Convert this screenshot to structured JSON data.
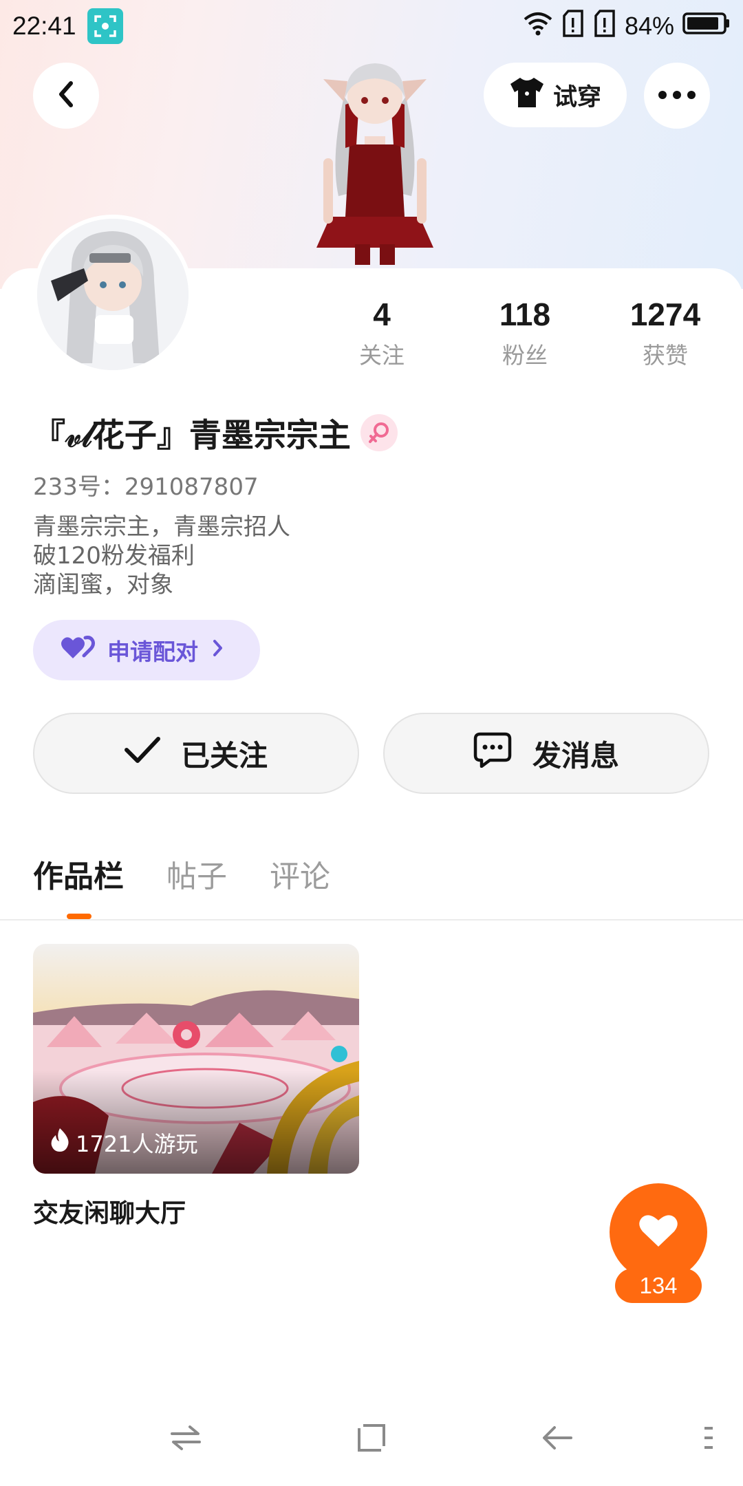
{
  "status_bar": {
    "time": "22:41",
    "battery": "84%"
  },
  "header": {
    "tryon_label": "试穿"
  },
  "profile": {
    "name": "『𝓋𝓁花子』青墨宗宗主",
    "id_line": "233号：291087807",
    "bio": [
      "青墨宗宗主，青墨宗招人",
      "破120粉发福利",
      "滴闺蜜，对象"
    ],
    "pair_label": "申请配对"
  },
  "stats": [
    {
      "value": "4",
      "label": "关注"
    },
    {
      "value": "118",
      "label": "粉丝"
    },
    {
      "value": "1274",
      "label": "获赞"
    }
  ],
  "actions": {
    "follow_label": "已关注",
    "message_label": "发消息"
  },
  "tabs": [
    {
      "label": "作品栏",
      "active": true
    },
    {
      "label": "帖子",
      "active": false
    },
    {
      "label": "评论",
      "active": false
    }
  ],
  "works": [
    {
      "title": "交友闲聊大厅",
      "plays": "1721人游玩"
    }
  ],
  "like": {
    "count": "134"
  },
  "colors": {
    "accent": "#ff6a10",
    "pair": "#6a56d8",
    "record": "#2ec4c6"
  }
}
